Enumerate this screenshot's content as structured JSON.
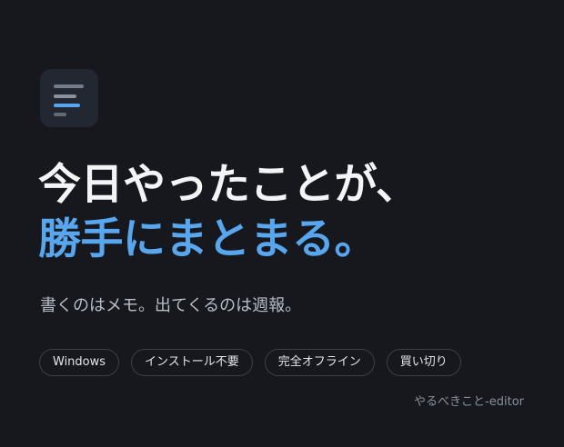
{
  "app_icon": {
    "icon": "menu-lines-icon",
    "accent_color": "#58a6ee"
  },
  "headline": {
    "line1": "今日やったことが、",
    "line2": "勝手にまとまる。",
    "line2_color": "#58a6ee"
  },
  "subtitle": "書くのはメモ。出てくるのは週報。",
  "tags": [
    "Windows",
    "インストール不要",
    "完全オフライン",
    "買い切り"
  ],
  "brand": "やるべきこと-editor",
  "colors": {
    "background": "#16181d",
    "accent": "#58a6ee",
    "text": "#f3f4f6",
    "muted": "#8a909c"
  }
}
